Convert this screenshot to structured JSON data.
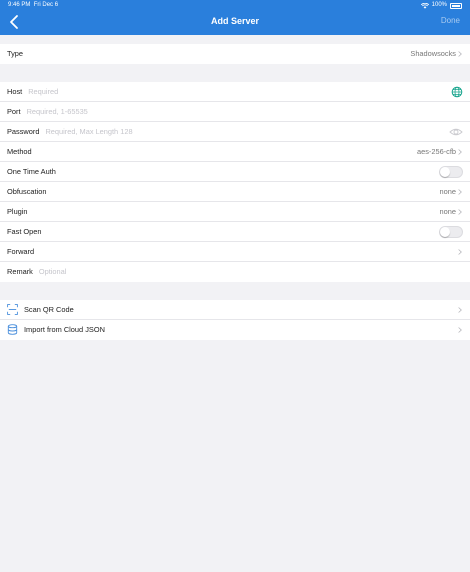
{
  "status": {
    "time": "9:46 PM",
    "date": "Fri Dec 6",
    "battery": "100%"
  },
  "nav": {
    "title": "Add Server",
    "done": "Done"
  },
  "type_row": {
    "label": "Type",
    "value": "Shadowsocks"
  },
  "form": {
    "host": {
      "label": "Host",
      "placeholder": "Required"
    },
    "port": {
      "label": "Port",
      "placeholder": "Required, 1-65535"
    },
    "password": {
      "label": "Password",
      "placeholder": "Required, Max Length 128"
    },
    "method": {
      "label": "Method",
      "value": "aes-256-cfb"
    },
    "one_time_auth": {
      "label": "One Time Auth"
    },
    "obfuscation": {
      "label": "Obfuscation",
      "value": "none"
    },
    "plugin": {
      "label": "Plugin",
      "value": "none"
    },
    "fast_open": {
      "label": "Fast Open"
    },
    "forward": {
      "label": "Forward"
    },
    "remark": {
      "label": "Remark",
      "placeholder": "Optional"
    }
  },
  "actions": {
    "scan_qr": {
      "label": "Scan QR Code"
    },
    "import_json": {
      "label": "Import from Cloud JSON"
    }
  },
  "colors": {
    "accent": "#2a7fdc",
    "icon_green": "#1aa58e"
  },
  "icons": [
    "back-chevron-icon",
    "wifi-icon",
    "battery-icon",
    "globe-icon",
    "eye-icon",
    "qr-scan-icon",
    "cloud-database-icon",
    "chevron-right-icon"
  ]
}
